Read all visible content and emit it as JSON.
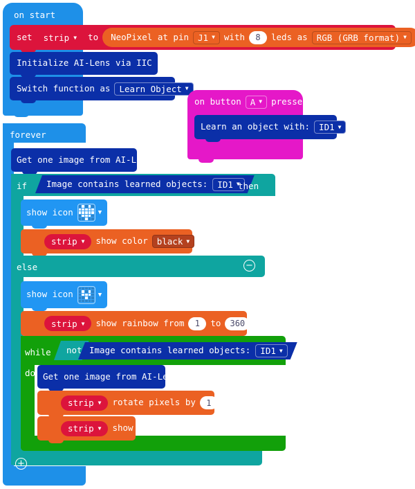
{
  "colors": {
    "event_blue": "#1e90e8",
    "event_magenta": "#e518c8",
    "loop_teal": "#0fa5a0",
    "loop_green": "#12a00a",
    "variable_red": "#dc143c",
    "neopixel_orange": "#eb6123",
    "ailens_navy": "#0b2fa8",
    "basic_blue": "#2196f3",
    "dropdown_dark": "#0b2fa8"
  },
  "blocks": {
    "on_start": {
      "label": "on start"
    },
    "set_var": {
      "set": "set",
      "variable": "strip",
      "to": "to",
      "neopixel_at_pin": "NeoPixel at pin",
      "pin": "J1",
      "with": "with",
      "leds_count": "8",
      "leds_as": "leds as",
      "mode": "RGB (GRB format)"
    },
    "init_ailens": {
      "label": "Initialize AI-Lens via IIC port"
    },
    "switch_function": {
      "prefix": "Switch function as",
      "value": "Learn Object"
    },
    "on_button_pressed": {
      "prefix": "on button",
      "button": "A",
      "suffix": "pressed"
    },
    "learn_object": {
      "prefix": "Learn an object with:",
      "id": "ID1"
    },
    "forever": {
      "label": "forever"
    },
    "get_image_1": {
      "label": "Get one image from AI-Lens"
    },
    "if_block": {
      "if": "if",
      "then": "then",
      "condition_prefix": "Image contains learned objects:",
      "condition_id": "ID1",
      "else": "else",
      "minus_glyph": "−",
      "plus_glyph": "+"
    },
    "show_icon_1": {
      "label": "show icon",
      "icon_name": "heart-icon"
    },
    "show_color": {
      "variable": "strip",
      "label": "show color",
      "color": "black"
    },
    "show_icon_2": {
      "label": "show icon",
      "icon_name": "small-heart-icon"
    },
    "show_rainbow": {
      "variable": "strip",
      "label": "show rainbow from",
      "from": "1",
      "to_label": "to",
      "to": "360"
    },
    "while_block": {
      "while": "while",
      "not": "not",
      "do": "do",
      "condition_prefix": "Image contains learned objects:",
      "condition_id": "ID1"
    },
    "get_image_2": {
      "label": "Get one image from AI-Lens"
    },
    "rotate_pixels": {
      "variable": "strip",
      "label": "rotate pixels by",
      "value": "1"
    },
    "strip_show": {
      "variable": "strip",
      "label": "show"
    }
  },
  "icons": {
    "heart": [
      0,
      1,
      0,
      1,
      0,
      1,
      1,
      1,
      1,
      1,
      1,
      1,
      1,
      1,
      1,
      0,
      1,
      1,
      1,
      0,
      0,
      0,
      1,
      0,
      0
    ],
    "small_heart": [
      0,
      0,
      0,
      0,
      0,
      0,
      1,
      0,
      1,
      0,
      0,
      1,
      1,
      1,
      0,
      0,
      0,
      1,
      0,
      0,
      0,
      0,
      0,
      0,
      0
    ]
  }
}
